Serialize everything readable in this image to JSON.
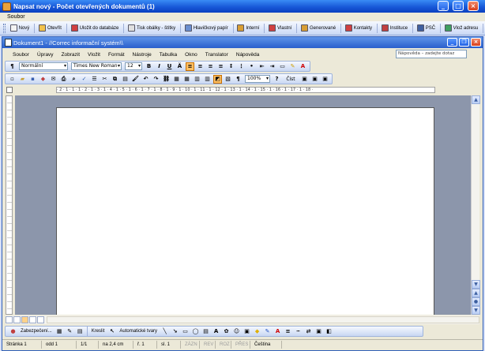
{
  "window": {
    "title": "Napsat nový - Počet otevřených dokumentů (1)"
  },
  "outer_menu": {
    "label": "Soubor"
  },
  "outer_toolbar": [
    {
      "label": "Nový",
      "icon": "new-doc-icon",
      "color": "#f3f3f3"
    },
    {
      "label": "Otevřít",
      "icon": "open-folder-icon",
      "color": "#f2c24b"
    },
    {
      "label": "Uložit do databáze",
      "icon": "save-db-icon",
      "color": "#d04040"
    },
    {
      "label": "Tisk obálky - štítky",
      "icon": "print-envelope-icon",
      "color": "#e0e0e0"
    },
    {
      "label": "Hlavičkový papír",
      "icon": "letterhead-icon",
      "color": "#6b8fd0"
    },
    {
      "label": "Interní",
      "icon": "internal-icon",
      "color": "#d89e34"
    },
    {
      "label": "Vlastní",
      "icon": "own-icon",
      "color": "#d04040"
    },
    {
      "label": "Generované",
      "icon": "generated-icon",
      "color": "#d89e34"
    },
    {
      "label": "Kontakty",
      "icon": "contacts-icon",
      "color": "#d04040"
    },
    {
      "label": "Instituce",
      "icon": "institution-icon",
      "color": "#c04040"
    },
    {
      "label": "PSČ",
      "icon": "zip-icon",
      "color": "#4060a0"
    },
    {
      "label": "Vlož adresu",
      "icon": "insert-address-icon",
      "color": "#40a060"
    }
  ],
  "document_window": {
    "title": "Dokument1 - //Correc informační systém\\\\"
  },
  "menubar": [
    "Soubor",
    "Úpravy",
    "Zobrazit",
    "Vložit",
    "Formát",
    "Nástroje",
    "Tabulka",
    "Okno",
    "Translator",
    "Nápověda"
  ],
  "help_box": {
    "placeholder": "Nápověda – zadejte dotaz"
  },
  "format_toolbar": {
    "style": "Normální",
    "font": "Times New Roman",
    "size": "12",
    "bold": "B",
    "italic": "I",
    "underline": "U"
  },
  "standard_toolbar": {
    "zoom": "100%",
    "read_label": "Číst"
  },
  "ruler": {
    "labels": "· 2 · 1 · 1 · 1 · 2 · 1 · 3 · 1 · 4 · 1 · 5 · 1 · 6 · 1 · 7 · 1 · 8 · 1 · 9 · 1 · 10 · 1 · 11 · 1 · 12 · 1 · 13 · 1 · 14 · 1 · 15 · 1 · 16 · 1 · 17 · 1 · 18 ·"
  },
  "draw_toolbar": {
    "draw_label": "Kreslit",
    "autoshapes_label": "Automatické tvary",
    "autosum_label": "Zabezpečení..."
  },
  "statusbar": {
    "page": "Stránka 1",
    "section": "odd 1",
    "pages": "1/1",
    "position": "na 2,4 cm",
    "line": "ř. 1",
    "column": "sl. 1",
    "rec": "ZÁZN",
    "rev": "REV",
    "ext": "ROZ",
    "ovr": "PŘES",
    "language": "Čeština"
  }
}
